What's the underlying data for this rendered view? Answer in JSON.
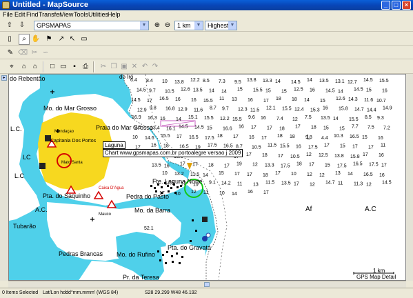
{
  "window": {
    "title": "Untitled - MapSource"
  },
  "menu": [
    "File",
    "Edit",
    "Find",
    "Transfer",
    "View",
    "Tools",
    "Utilities",
    "Help"
  ],
  "toolbar1": {
    "product": "GPSMAPAS",
    "zoom": "1 km",
    "detail": "Highest"
  },
  "map": {
    "tooltip_title": "Laguna",
    "tooltip_text": "Chart www.gpsmapas.com.br portoalegre versao j 2009",
    "scale_label": "1 km",
    "corner_label": "GPS Map Detail",
    "places": [
      "do Rebentão",
      "Mo. do Mar Grosso",
      "Praia do Mar Grosso",
      "Capitania Dos Portos",
      "Mendaçao",
      "Mato Santa",
      "L.C.",
      "LC",
      "L.C",
      "Caixa D'Agua",
      "Pta. do Saquinho",
      "Pedra do Pasto",
      "Fte. Laguna Norte",
      "Mo. da Barra",
      "A.C.",
      "Tubarão",
      "Mo. do Rufino",
      "Pedras Brancas",
      "Pta. do Gravatá",
      "Pr. da Teresa",
      "do Iró",
      "Mauco",
      "L",
      "Af",
      "A.C",
      "52.1"
    ],
    "depths": [
      "6.4",
      "8.4",
      "10",
      "13.8",
      "12.2",
      "8.5",
      "7.3",
      "9.5",
      "13.8",
      "13.3",
      "14",
      "14.5",
      "14",
      "13.5",
      "13.1",
      "12.7",
      "14.5",
      "15.5",
      "14.5",
      "9.7",
      "10.5",
      "12.6",
      "13.5",
      "14",
      "14",
      "15",
      "15.5",
      "15",
      "15",
      "12.5",
      "16",
      "14.5",
      "14",
      "14.5",
      "15",
      "16",
      "14.5",
      "17",
      "16.5",
      "16",
      "16",
      "15.5",
      "11",
      "13",
      "16",
      "17",
      "18",
      "18",
      "14",
      "15",
      "12.6",
      "14.3",
      "11.6",
      "10.7",
      "12.9",
      "9.8",
      "16.8",
      "12.9",
      "11.6",
      "8.7",
      "9.7",
      "12.3",
      "11.5",
      "12.1",
      "15.5",
      "12.4",
      "15.3",
      "16",
      "15.8",
      "14.7",
      "14.4",
      "14.9",
      "16.9",
      "16.3",
      "16",
      "14",
      "15.1",
      "15.5",
      "12.2",
      "15.5",
      "9.6",
      "16",
      "7.4",
      "12",
      "7.5",
      "13.5",
      "14",
      "15.5",
      "8.5",
      "9.3",
      "9.5",
      "13.4",
      "16.1",
      "14.5",
      "14.5",
      "15",
      "16.6",
      "16",
      "17",
      "17",
      "18",
      "17",
      "18",
      "15",
      "15",
      "7.7",
      "7.5",
      "7.2",
      "10",
      "14.6",
      "15.5",
      "17",
      "16.5",
      "17.5",
      "18",
      "17",
      "16",
      "17",
      "18",
      "18",
      "9.8",
      "4.4",
      "10.3",
      "16.5",
      "15",
      "16",
      "17",
      "16",
      "18",
      "16.5",
      "19",
      "17.5",
      "16.5",
      "8.7",
      "10.5",
      "11.5",
      "15.5",
      "16",
      "17.5",
      "17",
      "15",
      "17",
      "17",
      "11",
      "11.3",
      "15",
      "15.5",
      "16",
      "17",
      "18",
      "17",
      "17",
      "18",
      "17",
      "10.5",
      "12",
      "12.5",
      "13.8",
      "15.8",
      "17",
      "16",
      "13.5",
      "16",
      "17",
      "17",
      "18",
      "17",
      "19",
      "12",
      "13.3",
      "17.5",
      "18",
      "17",
      "15",
      "17.5",
      "16.5",
      "17.5",
      "17",
      "10",
      "13.2",
      "11.5",
      "14",
      "15",
      "17",
      "17",
      "18",
      "17",
      "10",
      "12",
      "12",
      "13",
      "14",
      "16.5",
      "16",
      "17.5",
      "17",
      "19",
      "9.1",
      "14.2",
      "11",
      "13",
      "11.5",
      "13.5",
      "17",
      "12",
      "14.7",
      "11",
      "11.3",
      "12",
      "14.5",
      "17",
      "10",
      "12",
      "11",
      "10",
      "14",
      "16",
      "17"
    ]
  },
  "status": {
    "items": "0 Items Selected",
    "format": "Lat/Lon hddd°mm.mmm' (WGS 84)",
    "coords": "S28 29.299 W48 46.192"
  },
  "colors": {
    "land": "#ffffff",
    "shallow": "#4fd0ea",
    "sandbank": "#f7d81f",
    "titlebar": "#0a5fd8"
  }
}
